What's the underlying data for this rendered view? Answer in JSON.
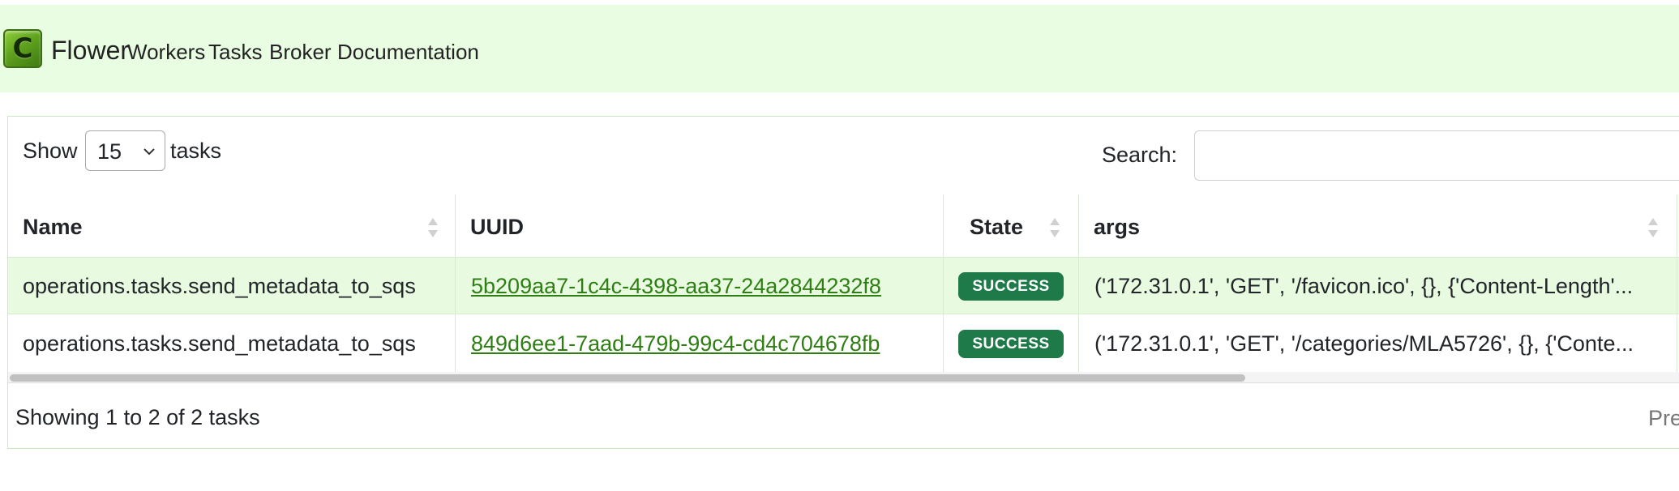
{
  "navbar": {
    "logo_letter": "C",
    "brand": "Flower",
    "links": [
      "Workers",
      "Tasks",
      "Broker",
      "Documentation"
    ]
  },
  "controls": {
    "show_label": "Show",
    "page_length": "15",
    "tasks_label": "tasks",
    "search_label": "Search:",
    "search_value": ""
  },
  "table": {
    "columns": [
      "Name",
      "UUID",
      "State",
      "args"
    ],
    "rows": [
      {
        "name": "operations.tasks.send_metadata_to_sqs",
        "uuid": "5b209aa7-1c4c-4398-aa37-24a2844232f8",
        "state": "SUCCESS",
        "args": "('172.31.0.1', 'GET', '/favicon.ico', {}, {'Content-Length'..."
      },
      {
        "name": "operations.tasks.send_metadata_to_sqs",
        "uuid": "849d6ee1-7aad-479b-99c4-cd4c704678fb",
        "state": "SUCCESS",
        "args": "('172.31.0.1', 'GET', '/categories/MLA5726', {}, {'Conte..."
      }
    ]
  },
  "footer": {
    "info": "Showing 1 to 2 of 2 tasks",
    "prev_label": "Pre"
  },
  "colors": {
    "navbar_bg": "#e9fde3",
    "link_green": "#2f7e13",
    "success_badge": "#1f7a4a",
    "odd_row_bg": "#e8fbe1"
  },
  "icons": {
    "sort": "sort-both-icon",
    "select": "chevron-down-icon"
  }
}
